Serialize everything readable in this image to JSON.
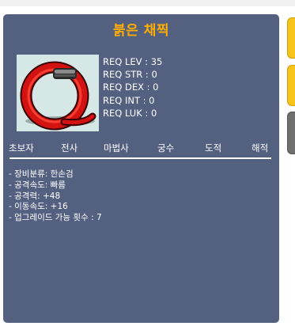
{
  "item": {
    "name": "붉은 채찍",
    "image_icon": "red-whip-icon"
  },
  "requirements": {
    "level": "REQ LEV : 35",
    "str": "REQ STR : 0",
    "dex": "REQ DEX : 0",
    "int": "REQ INT : 0",
    "luk": "REQ LUK : 0"
  },
  "jobs": [
    "초보자",
    "전사",
    "마법사",
    "궁수",
    "도적",
    "해적"
  ],
  "stats": [
    "- 장비분류: 한손검",
    "- 공격속도: 빠름",
    "- 공격력: +48",
    "- 이동속도: +16",
    "- 업그레이드 가능 횟수 : 7"
  ],
  "colors": {
    "panel_bg": "#53607f",
    "title": "#ffae00",
    "text": "#ffffff",
    "side_button_yellow": "#f7c51b",
    "side_button_gray": "#6f6f6f"
  }
}
